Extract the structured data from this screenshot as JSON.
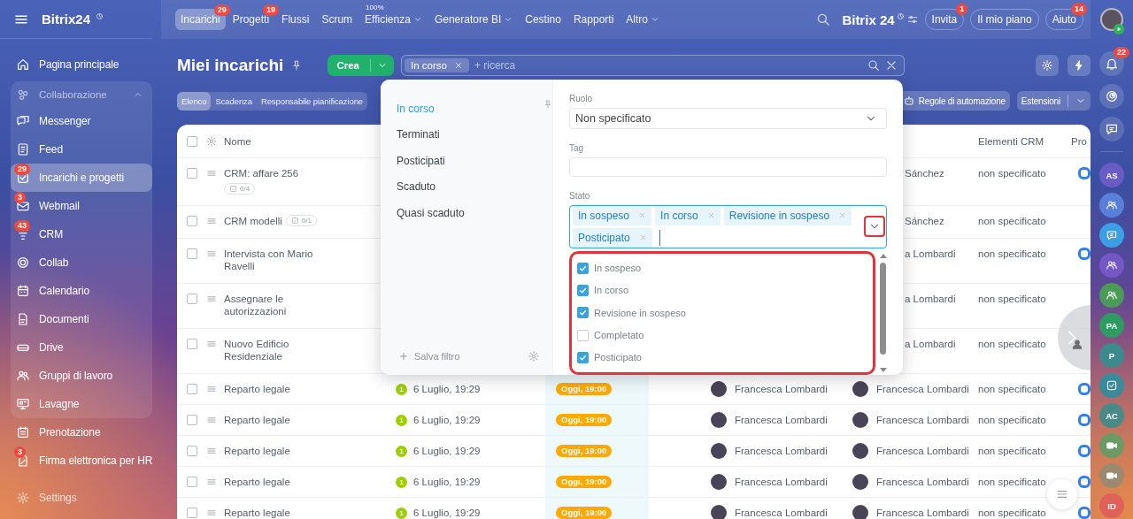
{
  "topbar": {
    "brand": "Bitrix24",
    "tabs": [
      {
        "label": "Incarichi",
        "selected": true,
        "badge": "29"
      },
      {
        "label": "Progetti",
        "selected": false,
        "badge": "19"
      },
      {
        "label": "Flussi",
        "selected": false
      },
      {
        "label": "Scrum",
        "selected": false
      },
      {
        "label": "Efficienza",
        "selected": false,
        "caption": "100%",
        "dropdown": true
      },
      {
        "label": "Generatore BI",
        "selected": false,
        "dropdown": true
      },
      {
        "label": "Cestino",
        "selected": false
      },
      {
        "label": "Rapporti",
        "selected": false
      },
      {
        "label": "Altro",
        "selected": false,
        "dropdown": true
      }
    ],
    "portal": "Bitrix 24",
    "buttons": [
      {
        "label": "Invita",
        "badge": "1"
      },
      {
        "label": "Il mio piano"
      },
      {
        "label": "Aiuto",
        "badge": "14"
      }
    ]
  },
  "sidebar": {
    "items": [
      {
        "kind": "link",
        "label": "Pagina principale",
        "selected": false
      },
      {
        "kind": "group",
        "label": "Collaborazione",
        "expanded": true,
        "children": [
          {
            "label": "Messenger",
            "selected": false
          },
          {
            "label": "Feed",
            "selected": false
          },
          {
            "label": "Incarichi e progetti",
            "selected": true,
            "badge": "29"
          },
          {
            "label": "Webmail",
            "selected": false,
            "badge": "3"
          },
          {
            "label": "CRM",
            "selected": false,
            "badge": "43"
          },
          {
            "label": "Collab",
            "selected": false
          },
          {
            "label": "Calendario",
            "selected": false
          },
          {
            "label": "Documenti",
            "selected": false
          },
          {
            "label": "Drive",
            "selected": false
          },
          {
            "label": "Gruppi di lavoro",
            "selected": false
          },
          {
            "label": "Lavagne",
            "selected": false
          }
        ]
      },
      {
        "kind": "link",
        "label": "Prenotazione",
        "selected": false
      },
      {
        "kind": "link",
        "label": "Firma elettronica per HR",
        "selected": false,
        "badge": "3"
      }
    ],
    "settings": "Settings"
  },
  "header": {
    "title": "Miei incarichi",
    "create": "Crea",
    "search": {
      "chips": [
        "In corso"
      ],
      "placeholder": "+ ricerca"
    }
  },
  "views": {
    "tabs": [
      {
        "label": "Elenco",
        "selected": true
      },
      {
        "label": "Scadenza",
        "selected": false
      },
      {
        "label": "Responsabile pianificazione",
        "selected": false
      }
    ],
    "automation": "Regole di automazione",
    "extensions": "Estensioni"
  },
  "table": {
    "columns": [
      "Nome",
      "Elementi CRM",
      "Pro"
    ],
    "all_checked": false,
    "rows": [
      {
        "checked": false,
        "name": "CRM: affare 256",
        "checklist": "0/4",
        "person2": {
          "name": "Sánchez",
          "avatar": false
        },
        "crm": "non specificato",
        "project": true
      },
      {
        "checked": false,
        "name": "CRM modelli",
        "checklist": "0/1",
        "person2": {
          "name": "Sánchez",
          "avatar": false
        },
        "crm": "non specificato",
        "project": false
      },
      {
        "checked": false,
        "name": "Intervista con Mario Ravelli",
        "person2": {
          "name": "a Lombardi",
          "avatar": false
        },
        "crm": "non specificato",
        "project": true
      },
      {
        "checked": false,
        "name": "Assegnare le autorizzazioni",
        "person2": {
          "name": "a Lombardi",
          "avatar": false
        },
        "crm": "non specificato",
        "project": false
      },
      {
        "checked": false,
        "name": "Nuovo Edificio Residenziale",
        "person2": {
          "name": "a Lombardi",
          "avatar": false
        },
        "crm": "non specificato",
        "project": false
      },
      {
        "checked": false,
        "name": "Reparto legale",
        "date_badge": "1",
        "date": "6 Luglio, 19:29",
        "deadline": "Oggi, 19:00",
        "responsible": "Francesca Lombardi",
        "person2": {
          "name": "Francesca Lombardi",
          "avatar": true
        },
        "crm": "non specificato",
        "project": true
      },
      {
        "checked": false,
        "name": "Reparto legale",
        "date_badge": "1",
        "date": "6 Luglio, 19:29",
        "deadline": "Oggi, 19:00",
        "responsible": "Francesca Lombardi",
        "person2": {
          "name": "Francesca Lombardi",
          "avatar": true
        },
        "crm": "non specificato",
        "project": true
      },
      {
        "checked": false,
        "name": "Reparto legale",
        "date_badge": "1",
        "date": "6 Luglio, 19:29",
        "deadline": "Oggi, 19:00",
        "responsible": "Francesca Lombardi",
        "person2": {
          "name": "Francesca Lombardi",
          "avatar": true
        },
        "crm": "non specificato",
        "project": true
      },
      {
        "checked": false,
        "name": "Reparto legale",
        "date_badge": "1",
        "date": "6 Luglio, 19:29",
        "deadline": "Oggi, 19:00",
        "responsible": "Francesca Lombardi",
        "person2": {
          "name": "Francesca Lombardi",
          "avatar": true
        },
        "crm": "non specificato",
        "project": true
      },
      {
        "checked": false,
        "name": "Reparto legale",
        "date_badge": "1",
        "date": "6 Luglio, 19:29",
        "deadline": "Oggi, 19:00",
        "responsible": "Francesca Lombardi",
        "person2": {
          "name": "Francesca Lombardi",
          "avatar": true
        },
        "crm": "non specificato",
        "project": true
      }
    ]
  },
  "filter": {
    "presets": [
      {
        "label": "In corso",
        "selected": true
      },
      {
        "label": "Terminati",
        "selected": false
      },
      {
        "label": "Posticipati",
        "selected": false
      },
      {
        "label": "Scaduto",
        "selected": false
      },
      {
        "label": "Quasi scaduto",
        "selected": false
      }
    ],
    "save": "Salva filtro",
    "role": {
      "label": "Ruolo",
      "value": "Non specificato"
    },
    "tag": {
      "label": "Tag"
    },
    "status": {
      "label": "Stato",
      "highlighted": true,
      "chips": [
        "In sospeso",
        "In corso",
        "Revisione in sospeso",
        "Posticipato"
      ],
      "options": [
        {
          "label": "In sospeso",
          "checked": true
        },
        {
          "label": "In corso",
          "checked": true
        },
        {
          "label": "Revisione in sospeso",
          "checked": true
        },
        {
          "label": "Completato",
          "checked": false
        },
        {
          "label": "Posticipato",
          "checked": true
        }
      ]
    }
  },
  "rail": {
    "notifications": "22",
    "items": [
      {
        "kind": "initials",
        "label": "AS",
        "color": "#6a5cc4"
      },
      {
        "kind": "group",
        "color": "#5a7fd8"
      },
      {
        "kind": "chat",
        "color": "#3b9fe6"
      },
      {
        "kind": "group",
        "color": "#7456c4"
      },
      {
        "kind": "group",
        "color": "#4c9a58"
      },
      {
        "kind": "initials",
        "label": "PA",
        "color": "#2f9a62"
      },
      {
        "kind": "initials",
        "label": "P",
        "color": "#3c8a8c"
      },
      {
        "kind": "task",
        "color": "#3a8a9c"
      },
      {
        "kind": "initials",
        "label": "AC",
        "color": "#4a8a86"
      },
      {
        "kind": "video",
        "color": "#6c9a64"
      },
      {
        "kind": "video",
        "color": "#9c8a70"
      },
      {
        "kind": "initials",
        "label": "ID",
        "color": "#e0605a"
      }
    ]
  }
}
